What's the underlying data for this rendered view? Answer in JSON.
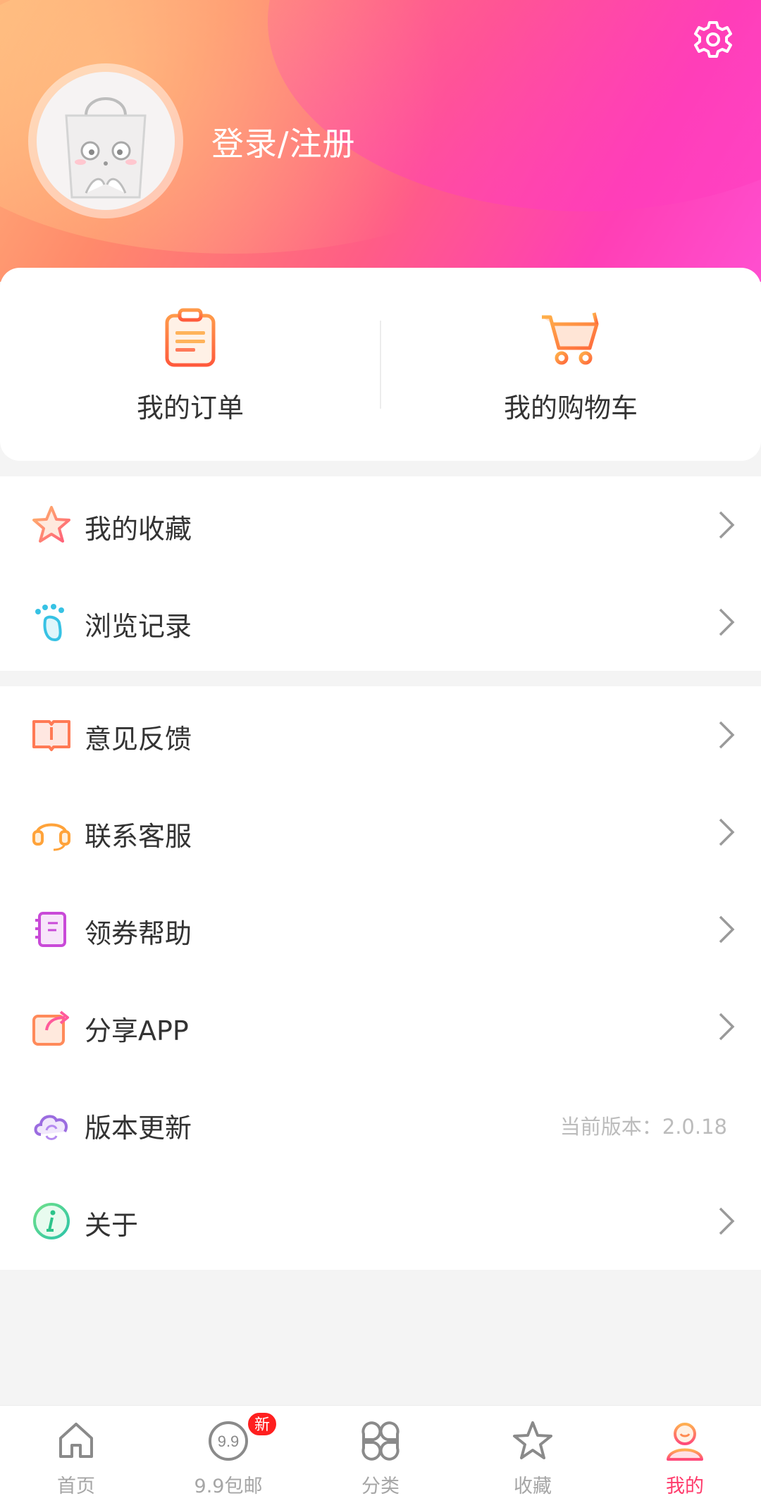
{
  "header": {
    "login_text": "登录/注册",
    "icons": {
      "settings": "gear-icon",
      "avatar": "bag-mascot-avatar"
    }
  },
  "quick_actions": [
    {
      "label": "我的订单",
      "icon": "clipboard-icon"
    },
    {
      "label": "我的购物车",
      "icon": "cart-icon"
    }
  ],
  "group1": [
    {
      "label": "我的收藏",
      "icon": "star-icon"
    },
    {
      "label": "浏览记录",
      "icon": "footprint-icon"
    }
  ],
  "group2": [
    {
      "label": "意见反馈",
      "icon": "feedback-icon"
    },
    {
      "label": "联系客服",
      "icon": "headset-icon"
    },
    {
      "label": "领券帮助",
      "icon": "notebook-icon"
    },
    {
      "label": "分享APP",
      "icon": "share-icon"
    },
    {
      "label": "版本更新",
      "icon": "cloud-sync-icon",
      "extra": "当前版本：2.0.18"
    },
    {
      "label": "关于",
      "icon": "info-icon"
    }
  ],
  "tabbar": [
    {
      "label": "首页",
      "icon": "home-icon"
    },
    {
      "label": "9.9包邮",
      "icon": "ninety-nine-icon",
      "badge": "新"
    },
    {
      "label": "分类",
      "icon": "category-icon"
    },
    {
      "label": "收藏",
      "icon": "star-outline-icon"
    },
    {
      "label": "我的",
      "icon": "profile-icon",
      "active": true
    }
  ],
  "colors": {
    "accent": "#ff3b6b",
    "header_start": "#ffb37a",
    "header_end": "#ff4fd0",
    "badge": "#ff1f1f"
  }
}
